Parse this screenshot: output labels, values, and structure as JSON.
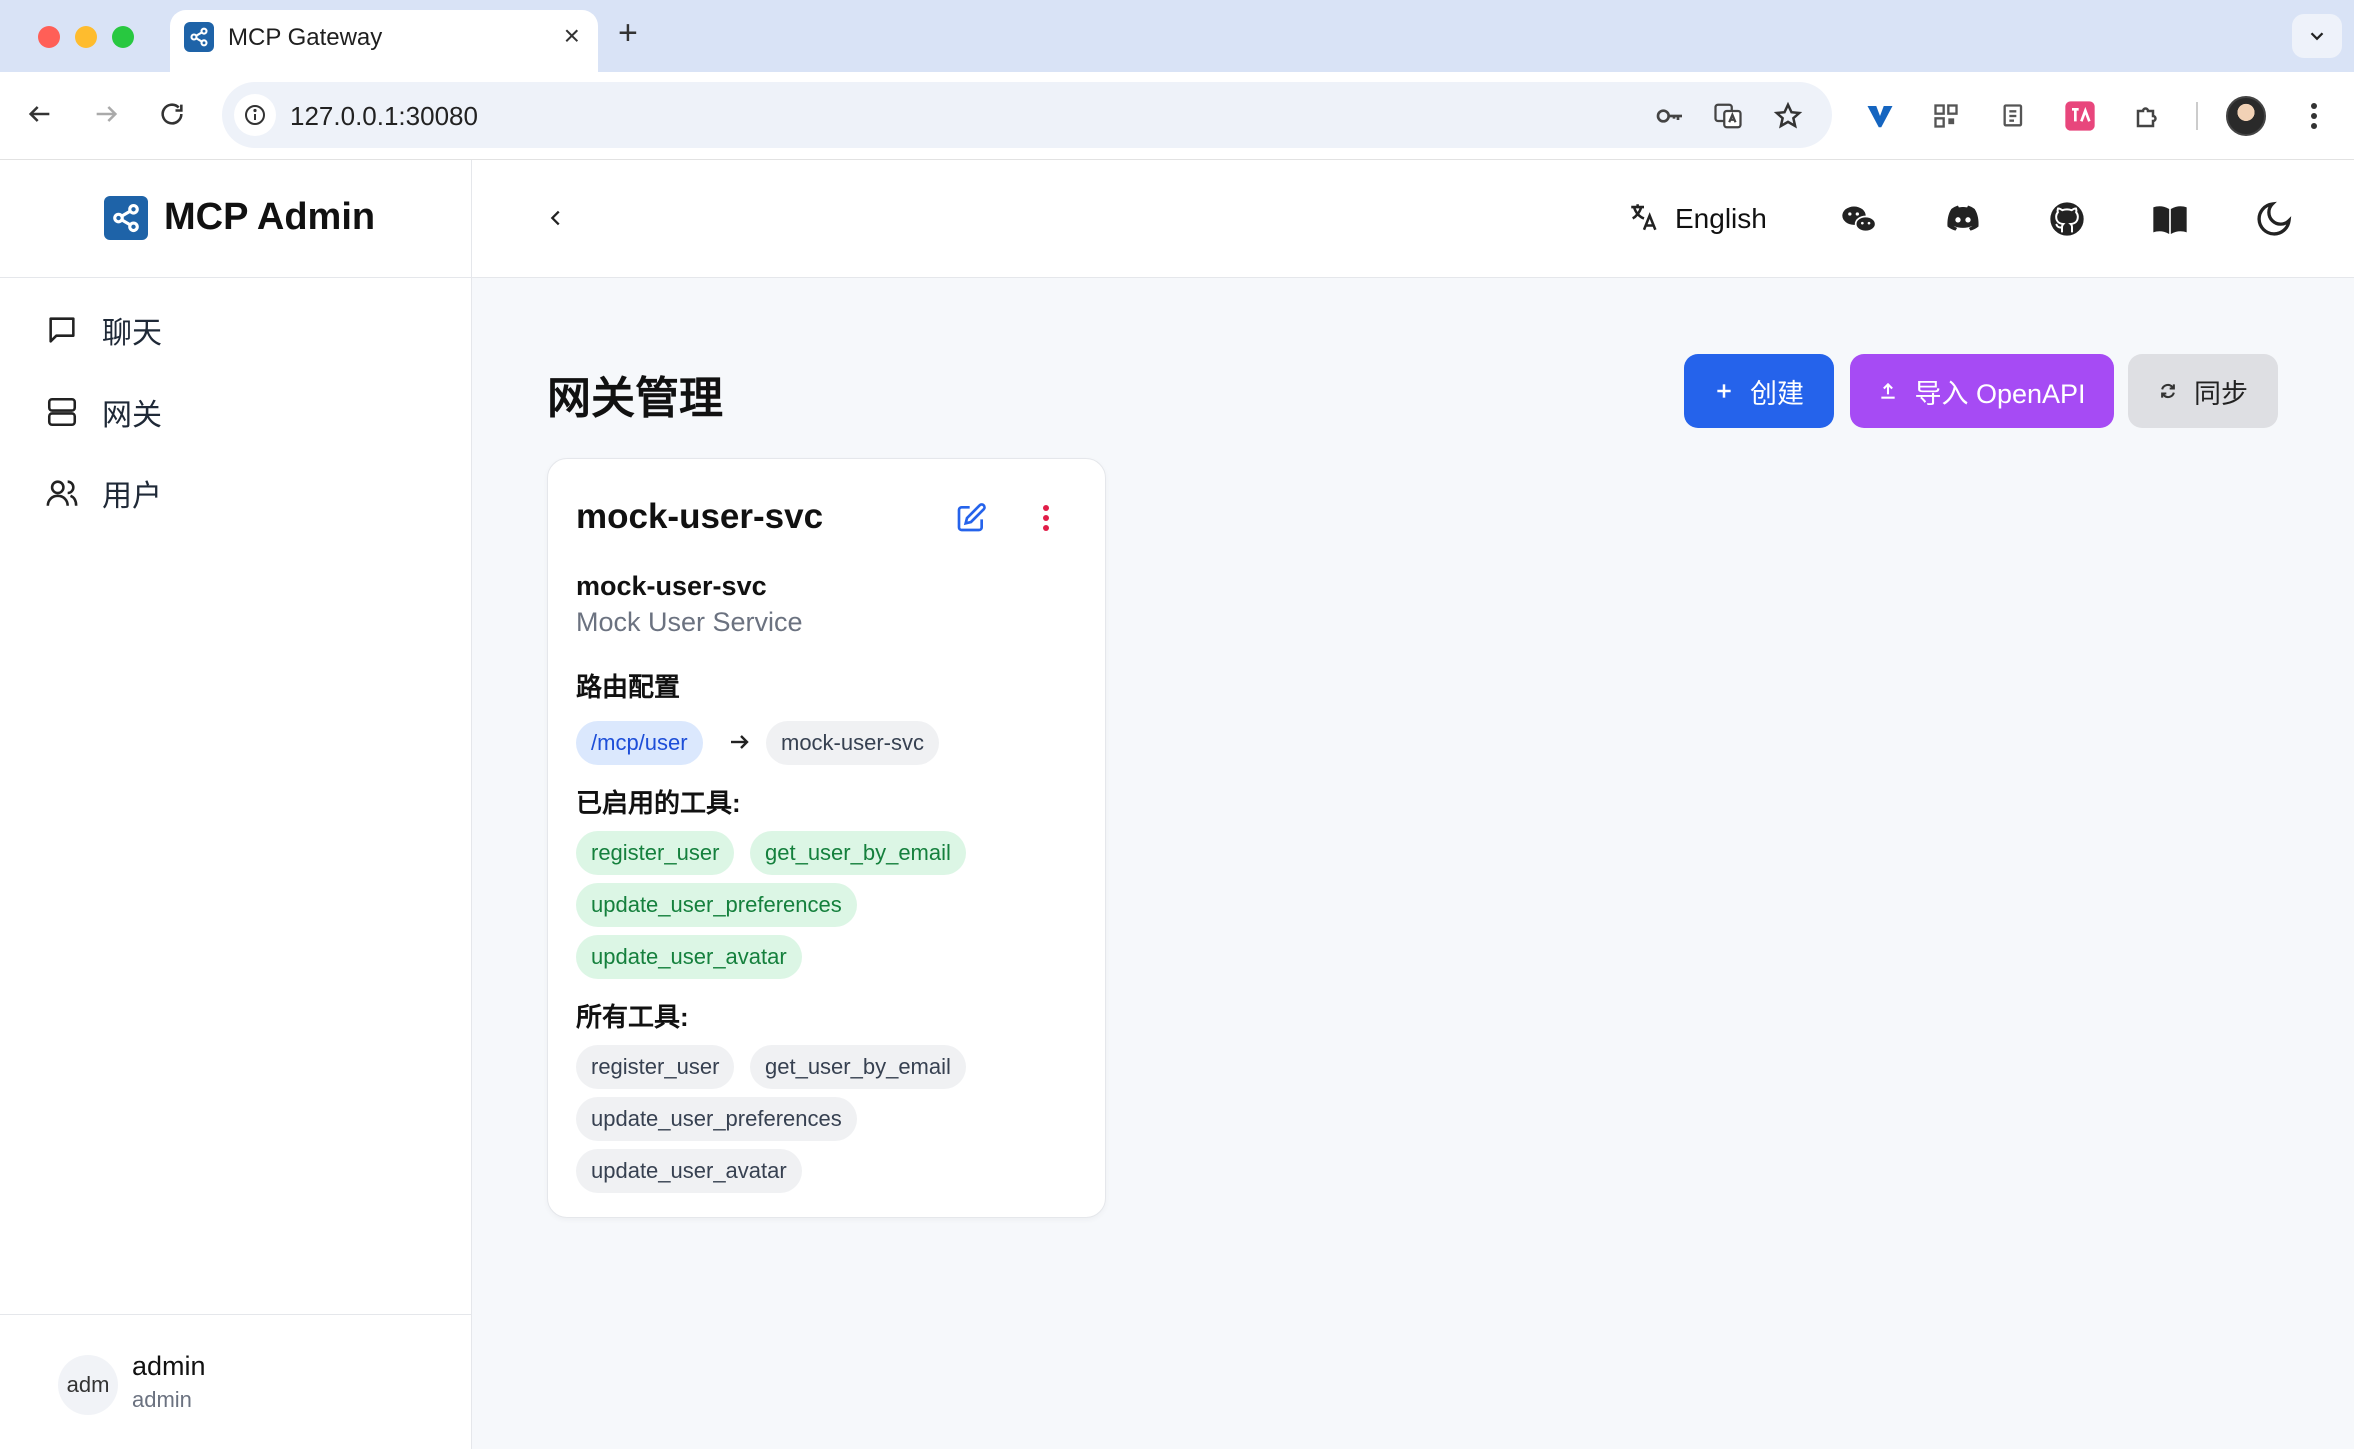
{
  "browser": {
    "tab_title": "MCP Gateway",
    "tab_close": "×",
    "new_tab": "+",
    "url": "127.0.0.1:30080"
  },
  "sidebar": {
    "brand": "MCP Admin",
    "items": [
      {
        "label": "聊天",
        "icon": "chat-icon"
      },
      {
        "label": "网关",
        "icon": "server-icon"
      },
      {
        "label": "用户",
        "icon": "users-icon"
      }
    ],
    "user": {
      "avatar": "adm",
      "name": "admin",
      "role": "admin"
    }
  },
  "header": {
    "language": "English",
    "icons": [
      "wechat-icon",
      "discord-icon",
      "github-icon",
      "docs-book-icon",
      "dark-mode-moon-icon"
    ]
  },
  "page": {
    "title": "网关管理",
    "buttons": {
      "create": "创建",
      "import": "导入 OpenAPI",
      "sync": "同步"
    }
  },
  "card": {
    "title": "mock-user-svc",
    "service_name": "mock-user-svc",
    "service_desc": "Mock User Service",
    "route_label": "路由配置",
    "route_prefix": "/mcp/user",
    "route_target": "mock-user-svc",
    "enabled_tools_label": "已启用的工具:",
    "enabled_tools": [
      "register_user",
      "get_user_by_email",
      "update_user_preferences",
      "update_user_avatar"
    ],
    "all_tools_label": "所有工具:",
    "all_tools": [
      "register_user",
      "get_user_by_email",
      "update_user_preferences",
      "update_user_avatar"
    ]
  },
  "colors": {
    "primary": "#2563eb",
    "import": "#a64bf4",
    "brand": "#1e63a8",
    "chip_green": "#15803d",
    "chip_blue": "#1d4ed8"
  }
}
